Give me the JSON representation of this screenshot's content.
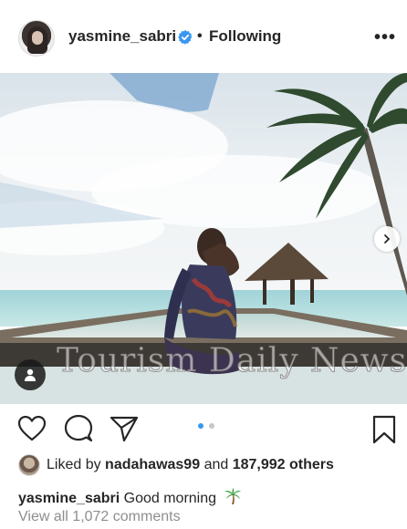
{
  "post": {
    "username": "yasmine_sabri",
    "separator": "•",
    "follow_status": "Following",
    "more_label": "•••",
    "watermark": "Tourism Daily News",
    "likes": {
      "prefix": "Liked by",
      "liker": "nadahawas99",
      "conjunction": "and",
      "others": "187,992 others"
    },
    "caption": {
      "author": "yasmine_sabri",
      "text": "Good morning"
    },
    "comments_link": "View all 1,072 comments",
    "carousel": {
      "count": 2,
      "active_index": 0
    }
  },
  "icons": {
    "verified": "verified-badge-icon",
    "more": "more-options-icon",
    "next": "chevron-right-icon",
    "tag": "user-tag-icon",
    "like": "heart-icon",
    "comment": "comment-icon",
    "share": "send-icon",
    "save": "bookmark-icon",
    "emoji": "palm-tree-emoji"
  },
  "colors": {
    "text": "#262626",
    "muted": "#8e8e8e",
    "verified": "#3897f0",
    "pager_active": "#3897f0",
    "pager_inactive": "#c7c7c7"
  }
}
